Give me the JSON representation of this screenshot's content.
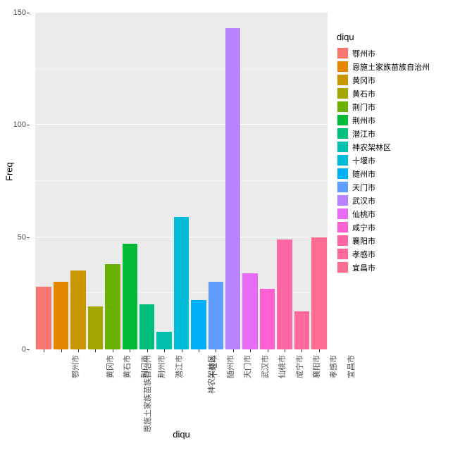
{
  "chart_data": {
    "type": "bar",
    "title": "",
    "xlabel": "diqu",
    "ylabel": "Freq",
    "ylim": [
      0,
      150
    ],
    "yticks": [
      0,
      50,
      100,
      150
    ],
    "legend_title": "diqu",
    "categories": [
      "鄂州市",
      "恩施土家族苗族自治州",
      "黄冈市",
      "黄石市",
      "荆门市",
      "荆州市",
      "潜江市",
      "神农架林区",
      "十堰市",
      "随州市",
      "天门市",
      "武汉市",
      "仙桃市",
      "咸宁市",
      "襄阳市",
      "孝感市",
      "宜昌市"
    ],
    "values": [
      28,
      30,
      35,
      19,
      38,
      47,
      20,
      8,
      59,
      22,
      30,
      143,
      34,
      27,
      49,
      17,
      50
    ],
    "colors": [
      "#F8766D",
      "#E58700",
      "#C99800",
      "#A3A500",
      "#6BB100",
      "#00BA38",
      "#00BF7D",
      "#00C0AF",
      "#00BCD8",
      "#00B0F6",
      "#619CFF",
      "#B983FF",
      "#E76BF3",
      "#FD61D1",
      "#FF67A4",
      "#FF699C",
      "#FF6C91"
    ]
  }
}
